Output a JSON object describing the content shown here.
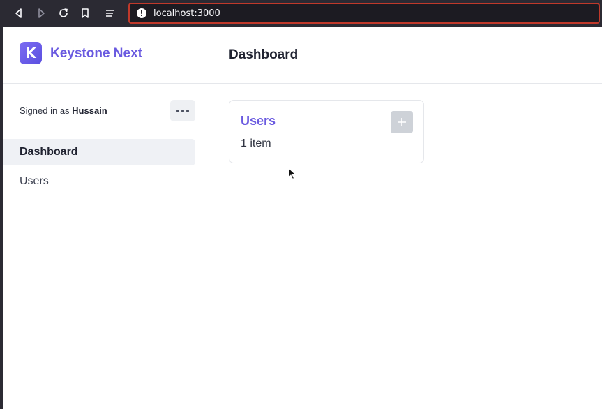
{
  "browser": {
    "url": "localhost:3000",
    "info_icon": "!"
  },
  "header": {
    "logo_letter": "K",
    "brand": "Keystone Next",
    "title": "Dashboard"
  },
  "sidebar": {
    "signed_in_prefix": "Signed in as ",
    "user_name": "Hussain",
    "items": [
      {
        "label": "Dashboard",
        "active": true
      },
      {
        "label": "Users",
        "active": false
      }
    ]
  },
  "main": {
    "cards": [
      {
        "title": "Users",
        "count": "1 item"
      }
    ]
  },
  "colors": {
    "accent": "#6a5ae0",
    "url_border": "#c0392b"
  }
}
